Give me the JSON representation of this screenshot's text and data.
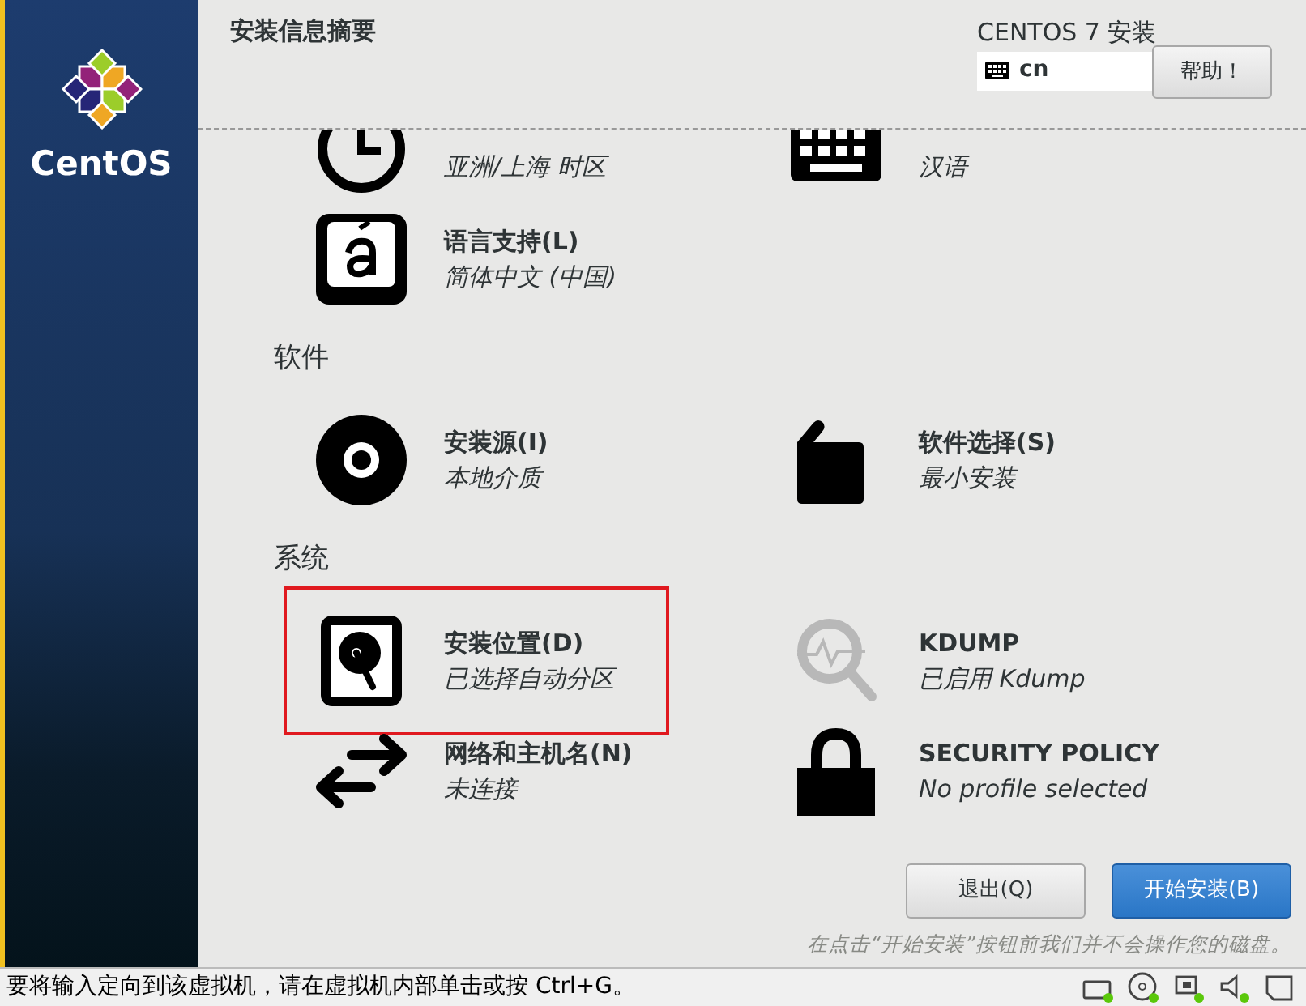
{
  "sidebar": {
    "logo_text": "CentOS"
  },
  "header": {
    "title": "安装信息摘要",
    "product": "CENTOS 7 安装",
    "keyboard_layout": "cn",
    "help_button": "帮助！"
  },
  "sections": [
    {
      "items": [
        {
          "kind": "clock",
          "subtitle": "亚洲/上海 时区",
          "highlighted": false
        },
        {
          "kind": "keyboard",
          "subtitle": "汉语",
          "highlighted": false
        },
        {
          "kind": "language",
          "title": "语言支持(L)",
          "subtitle": "简体中文 (中国)",
          "highlighted": false
        }
      ]
    },
    {
      "heading": "软件",
      "items": [
        {
          "kind": "disc",
          "title": "安装源(I)",
          "subtitle": "本地介质",
          "highlighted": false
        },
        {
          "kind": "package",
          "title": "软件选择(S)",
          "subtitle": "最小安装",
          "highlighted": false
        }
      ]
    },
    {
      "heading": "系统",
      "items": [
        {
          "kind": "disk",
          "title": "安装位置(D)",
          "subtitle": "已选择自动分区",
          "highlighted": true
        },
        {
          "kind": "kdump",
          "title": "KDUMP",
          "subtitle": "已启用 Kdump",
          "highlighted": false
        },
        {
          "kind": "network",
          "title": "网络和主机名(N)",
          "subtitle": "未连接",
          "highlighted": false
        },
        {
          "kind": "lock",
          "title": "SECURITY POLICY",
          "subtitle": "No profile selected",
          "highlighted": false
        }
      ]
    }
  ],
  "buttons": [
    {
      "label": "退出(Q)",
      "kind": "secondary"
    },
    {
      "label": "开始安装(B)",
      "kind": "primary"
    }
  ],
  "note": "在点击“开始安装”按钮前我们并不会操作您的磁盘。",
  "status_bar": {
    "message": "要将输入定向到该虚拟机，请在虚拟机内部单击或按 Ctrl+G。"
  }
}
